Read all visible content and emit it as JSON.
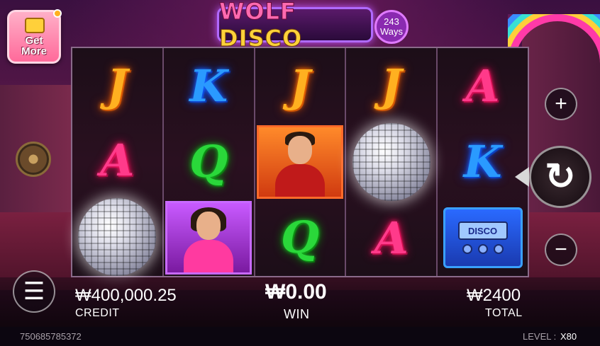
{
  "game": {
    "logo_part1": "WOLF",
    "logo_part2": "DISCO",
    "ways_number": "243",
    "ways_label": "Ways"
  },
  "promo": {
    "get_more_line1": "Get",
    "get_more_line2": "More"
  },
  "reels": [
    [
      "J",
      "A",
      "disco-ball"
    ],
    [
      "K",
      "Q",
      "woman-portrait"
    ],
    [
      "J",
      "man-portrait",
      "Q"
    ],
    [
      "J",
      "disco-ball",
      "A"
    ],
    [
      "A",
      "K",
      "radio"
    ]
  ],
  "radio_screen_text": "DISCO",
  "credit": {
    "value": "₩400,000.25",
    "label": "CREDIT"
  },
  "win": {
    "value": "₩0.00",
    "label": "WIN"
  },
  "bet": {
    "value": "₩2400",
    "label": "TOTAL"
  },
  "footer": {
    "round_id": "750685785372",
    "level_label": "LEVEL :",
    "level_value": "X80"
  },
  "controls": {
    "plus_symbol": "+",
    "minus_symbol": "−",
    "menu_symbol": "☰",
    "spin_symbol": "↻"
  }
}
